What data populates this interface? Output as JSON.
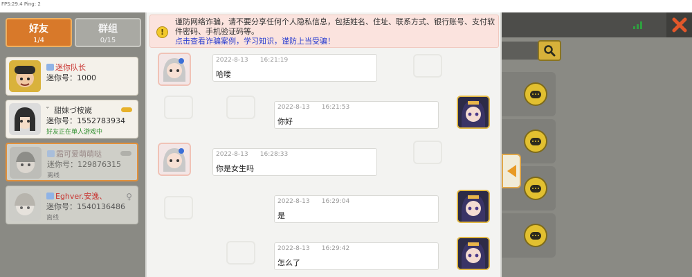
{
  "status_overlay": "FPS:29.4  Ping: 2",
  "tabs": [
    {
      "label": "好友",
      "count": "1/4",
      "active": true
    },
    {
      "label": "群组",
      "count": "0/15",
      "active": false
    }
  ],
  "friends": [
    {
      "name": "迷你队长",
      "uid": "迷你号：1000",
      "status": "",
      "badge": true
    },
    {
      "name": "゛甜妹づ桉嵗",
      "uid": "迷你号：1552783934",
      "status": "好友正在单人游戏中",
      "badge": false
    },
    {
      "name": "霜可爱萌萌哒",
      "uid": "迷你号：129876315",
      "status": "离线",
      "badge": true
    },
    {
      "name": "Eghver.安逸、",
      "uid": "迷你号：1540136486",
      "status": "离线",
      "badge": true
    }
  ],
  "warning": {
    "text": "谨防网络诈骗，请不要分享任何个人隐私信息，包括姓名、住址、联系方式、银行账号、支付软件密码、手机验证码等。",
    "link": "点击查看诈骗案例，学习知识，谨防上当受骗！"
  },
  "messages": [
    {
      "side": "left",
      "time": "2022-8-13      16:21:19",
      "text": "哈喽"
    },
    {
      "side": "right",
      "time": "2022-8-13      16:21:53",
      "text": "你好"
    },
    {
      "side": "left",
      "time": "2022-8-13      16:28:33",
      "text": "你是女生吗"
    },
    {
      "side": "right",
      "time": "2022-8-13      16:29:04",
      "text": "是"
    },
    {
      "side": "right",
      "time": "2022-8-13      16:29:42",
      "text": "怎么了"
    }
  ],
  "colors": {
    "accent": "#d8792a",
    "close": "#e2572a",
    "link": "#2a3ed0",
    "online": "#2f8f2f"
  }
}
